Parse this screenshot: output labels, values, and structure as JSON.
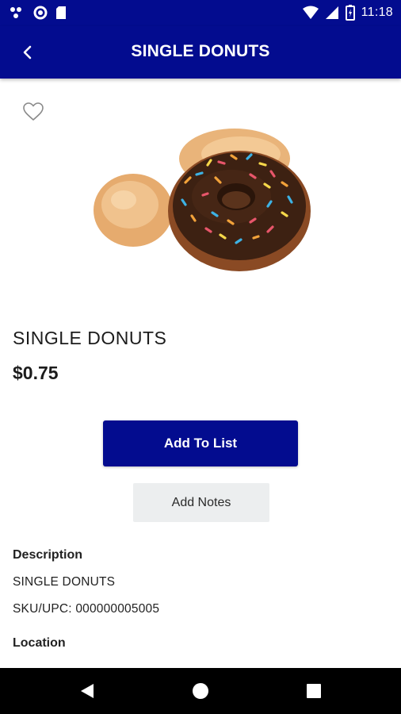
{
  "status_bar": {
    "time": "11:18",
    "left_icons": [
      "dots-icon",
      "circle-icon",
      "sd-card-icon"
    ],
    "right_icons": [
      "wifi-icon",
      "signal-icon",
      "battery-icon"
    ]
  },
  "app_bar": {
    "title": "SINGLE DONUTS",
    "back_icon": "chevron-left-icon",
    "color": "#030c8f"
  },
  "product": {
    "favorite_icon": "heart-outline-icon",
    "image": "donut-image",
    "name": "SINGLE DONUTS",
    "price": "$0.75"
  },
  "actions": {
    "add_to_list": "Add To List",
    "add_notes": "Add Notes"
  },
  "details": {
    "description_label": "Description",
    "description_text": "SINGLE DONUTS",
    "sku": "SKU/UPC: 000000005005",
    "location_label": "Location"
  },
  "nav_bar": {
    "buttons": [
      "back-triangle-icon",
      "home-circle-icon",
      "recents-square-icon"
    ]
  }
}
